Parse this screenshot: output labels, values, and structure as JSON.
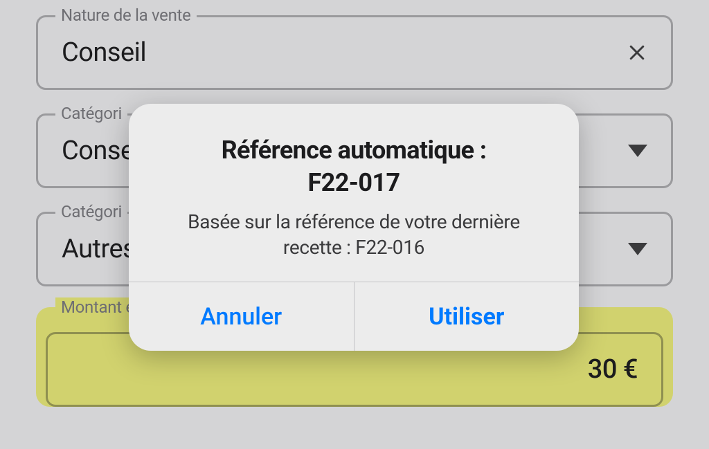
{
  "fields": {
    "nature": {
      "label": "Nature de la vente",
      "value": "Conseil"
    },
    "category1": {
      "label": "Catégori",
      "value": "Conse"
    },
    "category2": {
      "label": "Catégori",
      "value": "Autres"
    },
    "amount": {
      "label": "Montant encaissé TTC",
      "value": "30 €"
    }
  },
  "dialog": {
    "title_line1": "Référence automatique :",
    "title_line2": "F22-017",
    "subtitle": "Basée sur la référence de votre dernière recette : F22-016",
    "cancel": "Annuler",
    "confirm": "Utiliser"
  }
}
